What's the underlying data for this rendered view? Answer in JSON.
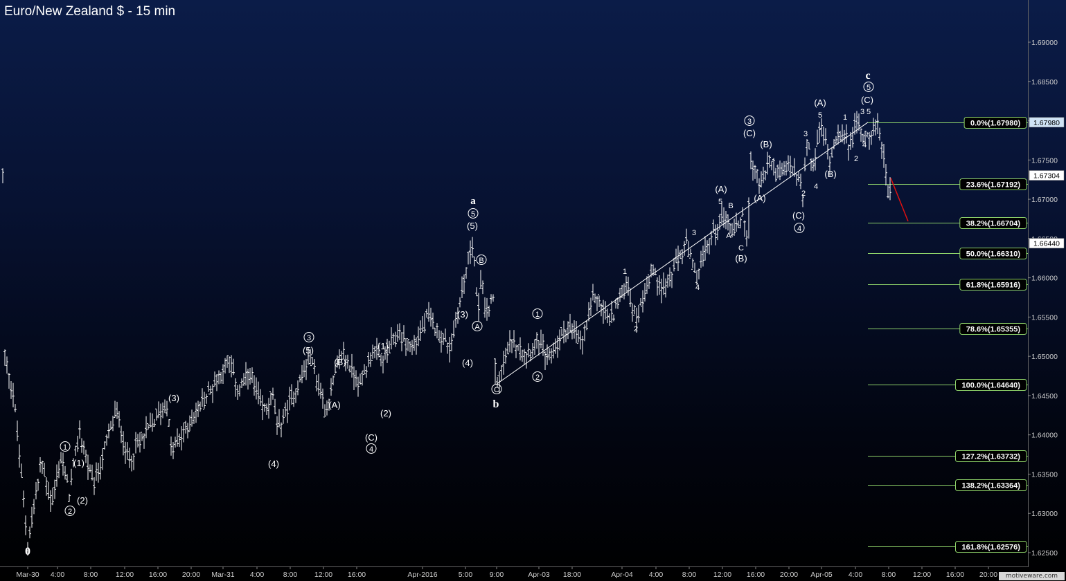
{
  "chart_data": {
    "type": "ohlc",
    "title": "Euro/New Zealand $ - 15 min",
    "watermark": "motiveware.com",
    "ylim": [
      1.6245,
      1.6945
    ],
    "y_ticks": [
      "1.62500",
      "1.63000",
      "1.63500",
      "1.64000",
      "1.64500",
      "1.65000",
      "1.65500",
      "1.66000",
      "1.66500",
      "1.67000",
      "1.67500",
      "1.68000",
      "1.68500",
      "1.69000"
    ],
    "x_ticks": [
      "Mar-30",
      "4:00",
      "8:00",
      "12:00",
      "16:00",
      "20:00",
      "Mar-31",
      "4:00",
      "8:00",
      "12:00",
      "16:00",
      "Apr-2016",
      "5:00",
      "9:00",
      "Apr-03",
      "18:00",
      "Apr-04",
      "4:00",
      "8:00",
      "12:00",
      "16:00",
      "20:00",
      "Apr-05",
      "4:00",
      "8:00",
      "12:00",
      "16:00",
      "20:00"
    ],
    "price_tags": [
      {
        "label": "1.67980",
        "value": 1.6798,
        "style": "light"
      },
      {
        "label": "1.67304",
        "value": 1.67304,
        "style": "white"
      },
      {
        "label": "1.66440",
        "value": 1.6644,
        "style": "white"
      }
    ],
    "fib_levels": [
      {
        "label": "0.0%(1.67980)",
        "value": 1.6798
      },
      {
        "label": "23.6%(1.67192)",
        "value": 1.67192
      },
      {
        "label": "38.2%(1.66704)",
        "value": 1.66704
      },
      {
        "label": "50.0%(1.66310)",
        "value": 1.6631
      },
      {
        "label": "61.8%(1.65916)",
        "value": 1.65916
      },
      {
        "label": "78.6%(1.65355)",
        "value": 1.65355
      },
      {
        "label": "100.0%(1.64640)",
        "value": 1.6464
      },
      {
        "label": "127.2%(1.63732)",
        "value": 1.63732
      },
      {
        "label": "138.2%(1.63364)",
        "value": 1.63364
      },
      {
        "label": "161.8%(1.62576)",
        "value": 1.62576
      }
    ],
    "trend_line": {
      "from": [
        1.6464
      ],
      "to": [
        1.6798
      ]
    },
    "projection_color": "#e01010",
    "series_color": "#ffffff",
    "wave_labels": [
      {
        "text": "0"
      },
      {
        "text": "1",
        "circled": true
      },
      {
        "text": "2",
        "circled": true
      },
      {
        "text": "(1)"
      },
      {
        "text": "(2)"
      },
      {
        "text": "(3)"
      },
      {
        "text": "(4)"
      },
      {
        "text": "3",
        "circled": true
      },
      {
        "text": "(5)"
      },
      {
        "text": "(A)"
      },
      {
        "text": "(B)"
      },
      {
        "text": "(C)"
      },
      {
        "text": "4",
        "circled": true
      },
      {
        "text": "(1)"
      },
      {
        "text": "(2)"
      },
      {
        "text": "(3)"
      },
      {
        "text": "(4)"
      },
      {
        "text": "a"
      },
      {
        "text": "5",
        "circled": true
      },
      {
        "text": "(5)"
      },
      {
        "text": "B",
        "circled": true
      },
      {
        "text": "A",
        "circled": true
      },
      {
        "text": "C",
        "circled": true
      },
      {
        "text": "b"
      },
      {
        "text": "1",
        "circled": true
      },
      {
        "text": "2",
        "circled": true
      },
      {
        "text": "1"
      },
      {
        "text": "2"
      },
      {
        "text": "3"
      },
      {
        "text": "4"
      },
      {
        "text": "(A)"
      },
      {
        "text": "5"
      },
      {
        "text": "B"
      },
      {
        "text": "A"
      },
      {
        "text": "C"
      },
      {
        "text": "(B)"
      },
      {
        "text": "3",
        "circled": true
      },
      {
        "text": "(C)"
      },
      {
        "text": "(A)"
      },
      {
        "text": "(B)"
      },
      {
        "text": "(A)"
      },
      {
        "text": "5"
      },
      {
        "text": "3"
      },
      {
        "text": "2"
      },
      {
        "text": "4"
      },
      {
        "text": "(B)"
      },
      {
        "text": "(C)"
      },
      {
        "text": "4",
        "circled": true
      },
      {
        "text": "1"
      },
      {
        "text": "2"
      },
      {
        "text": "3"
      },
      {
        "text": "5"
      },
      {
        "text": "4"
      },
      {
        "text": "c"
      },
      {
        "text": "5",
        "circled": true
      },
      {
        "text": "(C)"
      }
    ],
    "pivots": [
      [
        1.6505,
        1.6505
      ],
      [
        1.6448,
        1.6448
      ],
      [
        1.6262,
        1.6262
      ],
      [
        1.6365,
        1.6365
      ],
      [
        1.6312,
        1.6312
      ],
      [
        1.6372,
        1.6372
      ],
      [
        1.6325,
        1.6325
      ],
      [
        1.6405,
        1.6405
      ],
      [
        1.6332,
        1.6332
      ],
      [
        1.6432,
        1.6432
      ],
      [
        1.6368,
        1.6368
      ],
      [
        1.6442,
        1.6442
      ],
      [
        1.6378,
        1.6378
      ],
      [
        1.6495,
        1.6495
      ],
      [
        1.6455,
        1.6455
      ],
      [
        1.6478,
        1.6478
      ],
      [
        1.643,
        1.643
      ],
      [
        1.645,
        1.645
      ],
      [
        1.6405,
        1.6405
      ],
      [
        1.65,
        1.65
      ],
      [
        1.6432,
        1.6432
      ],
      [
        1.6505,
        1.6505
      ],
      [
        1.6465,
        1.6465
      ],
      [
        1.6505,
        1.6505
      ],
      [
        1.6495,
        1.6495
      ],
      [
        1.653,
        1.653
      ],
      [
        1.651,
        1.651
      ],
      [
        1.655,
        1.655
      ],
      [
        1.651,
        1.651
      ],
      [
        1.6652,
        1.6652
      ],
      [
        1.6545,
        1.6545
      ],
      [
        1.661,
        1.661
      ],
      [
        1.6555,
        1.6555
      ],
      [
        1.6572,
        1.6572
      ],
      [
        1.6464,
        1.6464
      ],
      [
        1.6522,
        1.6522
      ],
      [
        1.6505,
        1.6505
      ],
      [
        1.652,
        1.652
      ],
      [
        1.6495,
        1.6495
      ],
      [
        1.654,
        1.654
      ],
      [
        1.6515,
        1.6515
      ],
      [
        1.658,
        1.658
      ],
      [
        1.6545,
        1.6545
      ],
      [
        1.6595,
        1.6595
      ],
      [
        1.6545,
        1.6545
      ],
      [
        1.661,
        1.661
      ],
      [
        1.6585,
        1.6585
      ],
      [
        1.6645,
        1.6645
      ],
      [
        1.6598,
        1.6598
      ],
      [
        1.665,
        1.665
      ],
      [
        1.668,
        1.668
      ],
      [
        1.666,
        1.666
      ],
      [
        1.668,
        1.668
      ],
      [
        1.665,
        1.665
      ],
      [
        1.6755,
        1.6755
      ],
      [
        1.6715,
        1.6715
      ],
      [
        1.675,
        1.675
      ],
      [
        1.673,
        1.673
      ],
      [
        1.6745,
        1.6745
      ],
      [
        1.6725,
        1.6725
      ],
      [
        1.6728,
        1.6728
      ],
      [
        1.669,
        1.669
      ],
      [
        1.677,
        1.677
      ],
      [
        1.674,
        1.674
      ],
      [
        1.6795,
        1.6795
      ],
      [
        1.675,
        1.675
      ],
      [
        1.679,
        1.679
      ],
      [
        1.677,
        1.677
      ],
      [
        1.6798,
        1.6798
      ],
      [
        1.678,
        1.678
      ],
      [
        1.679,
        1.679
      ],
      [
        1.6745,
        1.6745
      ],
      [
        1.6705,
        1.6705
      ],
      [
        1.673,
        1.673
      ]
    ]
  }
}
